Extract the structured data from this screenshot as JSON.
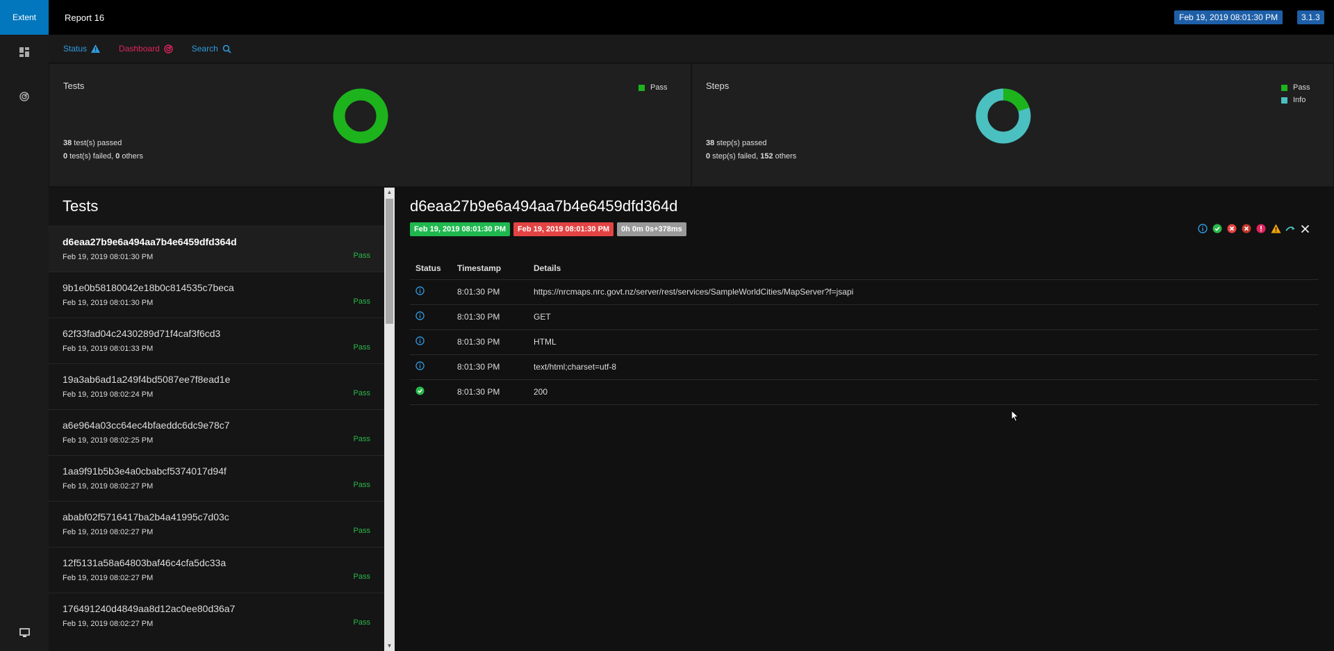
{
  "app": {
    "brand": "Extent",
    "report_name": "Report 16",
    "date_badge": "Feb 19, 2019 08:01:30 PM",
    "version": "3.1.3"
  },
  "nav": {
    "status": "Status",
    "dashboard": "Dashboard",
    "search": "Search"
  },
  "tests_card": {
    "title": "Tests",
    "legend": [
      "Pass"
    ],
    "line1_bold": "38",
    "line1_rest": " test(s) passed",
    "line2_bold1": "0",
    "line2_mid": " test(s) failed, ",
    "line2_bold2": "0",
    "line2_rest": " others"
  },
  "steps_card": {
    "title": "Steps",
    "legend": [
      "Pass",
      "Info"
    ],
    "line1_bold": "38",
    "line1_rest": " step(s) passed",
    "line2_bold1": "0",
    "line2_mid": " step(s) failed, ",
    "line2_bold2": "152",
    "line2_rest": " others"
  },
  "colors": {
    "pass": "#1db31d",
    "info": "#4bc0c0",
    "accent": "#0277bd",
    "fail": "#e44343"
  },
  "list": {
    "title": "Tests",
    "items": [
      {
        "name": "d6eaa27b9e6a494aa7b4e6459dfd364d",
        "time": "Feb 19, 2019 08:01:30 PM",
        "status": "Pass"
      },
      {
        "name": "9b1e0b58180042e18b0c814535c7beca",
        "time": "Feb 19, 2019 08:01:30 PM",
        "status": "Pass"
      },
      {
        "name": "62f33fad04c2430289d71f4caf3f6cd3",
        "time": "Feb 19, 2019 08:01:33 PM",
        "status": "Pass"
      },
      {
        "name": "19a3ab6ad1a249f4bd5087ee7f8ead1e",
        "time": "Feb 19, 2019 08:02:24 PM",
        "status": "Pass"
      },
      {
        "name": "a6e964a03cc64ec4bfaeddc6dc9e78c7",
        "time": "Feb 19, 2019 08:02:25 PM",
        "status": "Pass"
      },
      {
        "name": "1aa9f91b5b3e4a0cbabcf5374017d94f",
        "time": "Feb 19, 2019 08:02:27 PM",
        "status": "Pass"
      },
      {
        "name": "ababf02f5716417ba2b4a41995c7d03c",
        "time": "Feb 19, 2019 08:02:27 PM",
        "status": "Pass"
      },
      {
        "name": "12f5131a58a64803baf46c4cfa5dc33a",
        "time": "Feb 19, 2019 08:02:27 PM",
        "status": "Pass"
      },
      {
        "name": "176491240d4849aa8d12ac0ee80d36a7",
        "time": "Feb 19, 2019 08:02:27 PM",
        "status": "Pass"
      }
    ]
  },
  "detail": {
    "title": "d6eaa27b9e6a494aa7b4e6459dfd364d",
    "start": "Feb 19, 2019 08:01:30 PM",
    "end": "Feb 19, 2019 08:01:30 PM",
    "duration": "0h 0m 0s+378ms",
    "columns": [
      "Status",
      "Timestamp",
      "Details"
    ],
    "rows": [
      {
        "status_icon": "info-icon",
        "time": "8:01:30 PM",
        "details": "https://nrcmaps.nrc.govt.nz/server/rest/services/SampleWorldCities/MapServer?f=jsapi"
      },
      {
        "status_icon": "info-icon",
        "time": "8:01:30 PM",
        "details": "GET"
      },
      {
        "status_icon": "info-icon",
        "time": "8:01:30 PM",
        "details": "HTML"
      },
      {
        "status_icon": "info-icon",
        "time": "8:01:30 PM",
        "details": "text/html;charset=utf-8"
      },
      {
        "status_icon": "pass-icon",
        "time": "8:01:30 PM",
        "details": "200"
      }
    ]
  }
}
